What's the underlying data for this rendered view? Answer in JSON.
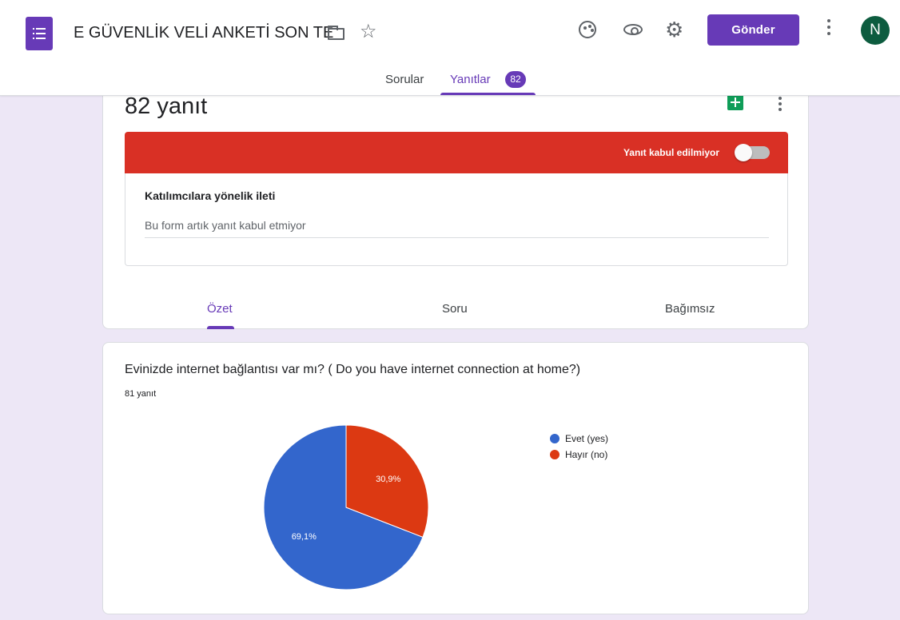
{
  "header": {
    "form_title": "E GÜVENLİK VELİ ANKETİ SON TE",
    "send_label": "Gönder",
    "avatar_letter": "N",
    "brand_color": "#673ab7"
  },
  "tabs": {
    "questions_label": "Sorular",
    "responses_label": "Yanıtlar",
    "responses_badge": "82"
  },
  "responses": {
    "count_label": "82 yanıt",
    "status_label": "Yanıt kabul edilmiyor",
    "accepting": false,
    "message_heading": "Katılımcılara yönelik ileti",
    "message_text": "Bu form artık yanıt kabul etmiyor",
    "view_tabs": [
      "Özet",
      "Soru",
      "Bağımsız"
    ]
  },
  "question": {
    "title": "Evinizde internet bağlantısı var mı? ( Do you have internet connection at home?)",
    "response_count": "81 yanıt"
  },
  "chart_data": {
    "type": "pie",
    "categories": [
      "Evet (yes)",
      "Hayır (no)"
    ],
    "values": [
      69.1,
      30.9
    ],
    "value_labels": [
      "69,1%",
      "30,9%"
    ],
    "colors": [
      "#3366cc",
      "#dc3912"
    ],
    "legend_position": "right"
  }
}
